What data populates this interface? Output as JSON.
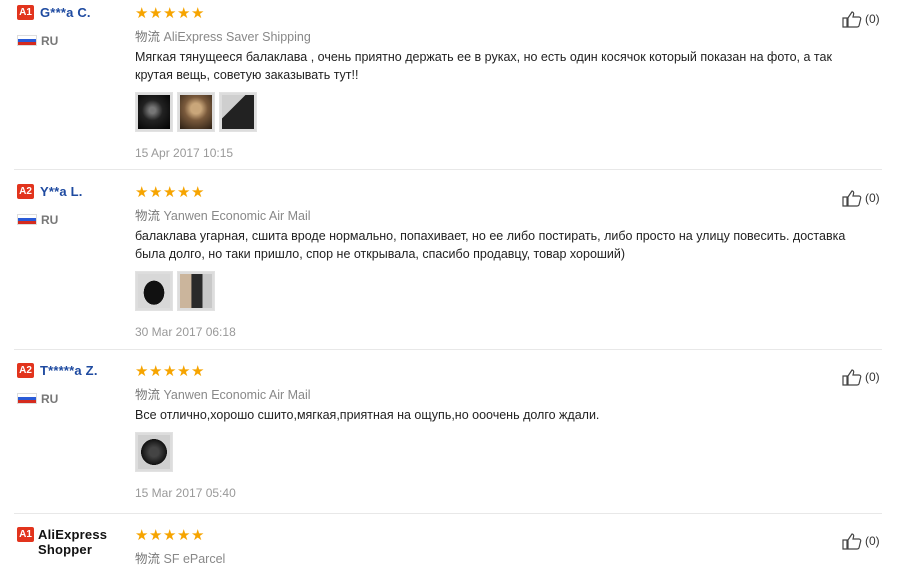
{
  "reviews": [
    {
      "level": "A1",
      "user": "G***a C.",
      "country": "RU",
      "shipping_prefix": "物流",
      "shipping": "AliExpress Saver Shipping",
      "text": "Мягкая тянущееся балаклава , очень приятно держать ее в руках, но есть один косячок который показан на фото, а так крутая вещь, советую заказывать тут!!",
      "date": "15 Apr 2017 10:15",
      "helpful": "(0)",
      "stars": 5
    },
    {
      "level": "A2",
      "user": "Y**a L.",
      "country": "RU",
      "shipping_prefix": "物流",
      "shipping": "Yanwen Economic Air Mail",
      "text": "балаклава угарная, сшита вроде нормально, попахивает, но ее либо постирать, либо просто на улицу повесить. доставка была долго, но таки пришло, спор не открывала, спасибо продавцу, товар хороший)",
      "date": "30 Mar 2017 06:18",
      "helpful": "(0)",
      "stars": 5
    },
    {
      "level": "A2",
      "user": "T*****a Z.",
      "country": "RU",
      "shipping_prefix": "物流",
      "shipping": "Yanwen Economic Air Mail",
      "text": "Все отлично,хорошо сшито,мягкая,приятная на ощупь,но ооочень долго ждали.",
      "date": "15 Mar 2017 05:40",
      "helpful": "(0)",
      "stars": 5
    },
    {
      "level": "A1",
      "user": "AliExpress Shopper",
      "shipping_prefix": "物流",
      "shipping": "SF eParcel",
      "helpful": "(0)",
      "stars": 5
    }
  ],
  "colors": {
    "level_badge": "#e2341d",
    "username": "#1e4aa0",
    "star": "#f6a400"
  },
  "icons": {
    "rating": "star-icon",
    "helpful": "thumbs-up-icon",
    "flag": "russia-flag-icon"
  }
}
